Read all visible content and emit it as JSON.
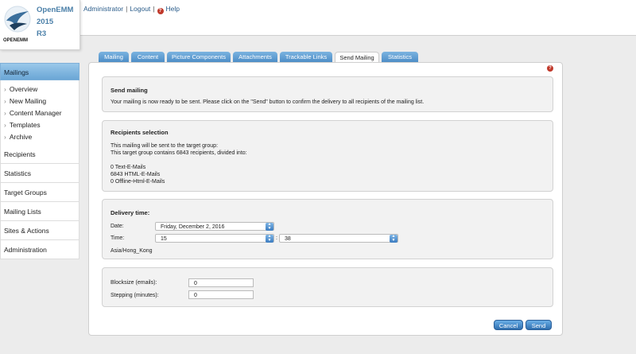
{
  "app": {
    "name_lines": [
      "OpenEMM",
      "2015",
      "R3"
    ],
    "logo_small": "OPENEMM"
  },
  "toplinks": {
    "user": "Administrator",
    "logout": "Logout",
    "help": "Help",
    "help_mark": "?"
  },
  "sidebar": {
    "active": "Mailings",
    "sub_items": [
      "Overview",
      "New Mailing",
      "Content Manager",
      "Templates",
      "Archive"
    ],
    "items": [
      "Recipients",
      "Statistics",
      "Target Groups",
      "Mailing Lists",
      "Sites & Actions",
      "Administration"
    ]
  },
  "tabs": [
    "Mailing",
    "Content",
    "Picture Components",
    "Attachments",
    "Trackable Links",
    "Send Mailing",
    "Statistics"
  ],
  "send": {
    "title": "Send mailing",
    "text": "Your mailing is now ready to be sent. Please click on the \"Send\" button to confirm the delivery to all recipients of the mailing list."
  },
  "recipients": {
    "title": "Recipients selection",
    "line1": "This mailing will be sent to the target group:",
    "line2": "This target group contains 6843 recipients, divided into:",
    "text_mails": "0 Text-E-Mails",
    "html_mails": "6843 HTML-E-Mails",
    "offline_mails": "0 Offline-Html-E-Mails"
  },
  "delivery": {
    "title": "Delivery time:",
    "date_label": "Date:",
    "date_value": "Friday, December 2, 2016",
    "time_label": "Time:",
    "hour": "15",
    "colon": ":",
    "minute": "38",
    "timezone": "Asia/Hong_Kong"
  },
  "blocks": {
    "blocksize_label": "Blocksize (emails):",
    "blocksize_value": "0",
    "stepping_label": "Stepping (minutes):",
    "stepping_value": "0"
  },
  "buttons": {
    "cancel": "Cancel",
    "send": "Send"
  },
  "colors": {
    "accent": "#4a8bc5",
    "help": "#c0392b"
  }
}
